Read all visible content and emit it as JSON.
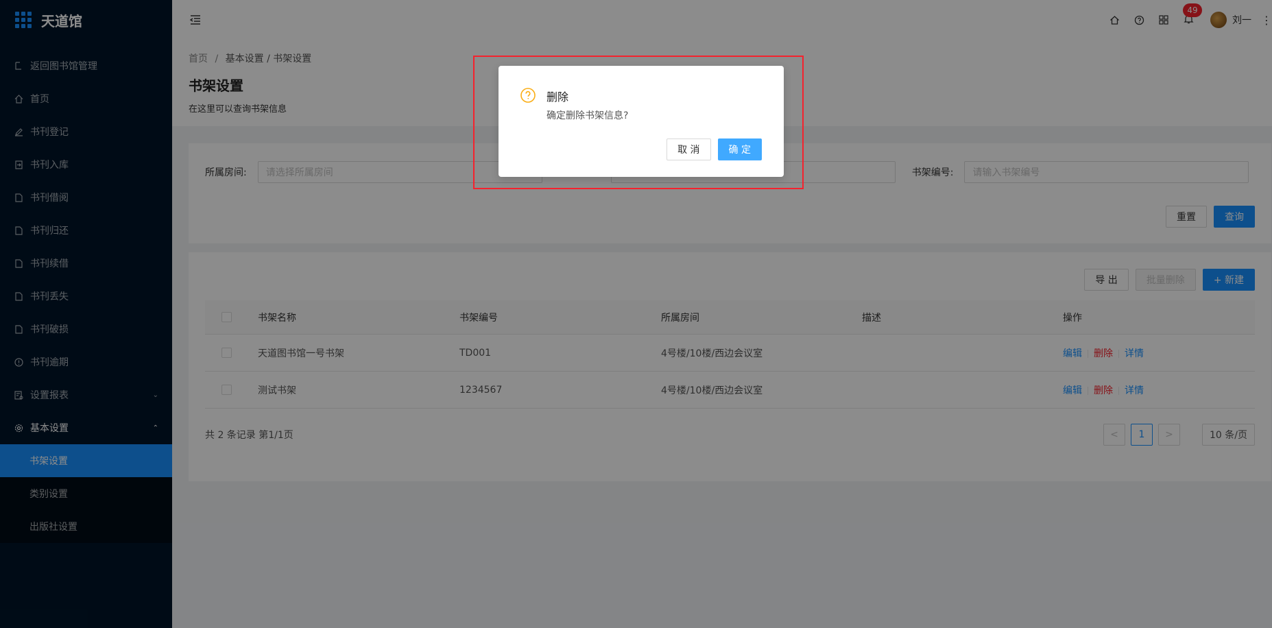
{
  "app": {
    "name": "天道馆"
  },
  "sidebar": {
    "items": [
      {
        "label": "返回图书馆管理",
        "icon": "return-icon"
      },
      {
        "label": "首页",
        "icon": "home-icon"
      },
      {
        "label": "书刊登记",
        "icon": "edit-icon"
      },
      {
        "label": "书刊入库",
        "icon": "import-icon"
      },
      {
        "label": "书刊借阅",
        "icon": "file-icon"
      },
      {
        "label": "书刊归还",
        "icon": "file-icon"
      },
      {
        "label": "书刊续借",
        "icon": "file-icon"
      },
      {
        "label": "书刊丢失",
        "icon": "file-icon"
      },
      {
        "label": "书刊破损",
        "icon": "file-icon"
      },
      {
        "label": "书刊逾期",
        "icon": "warning-circle-icon"
      },
      {
        "label": "设置报表",
        "icon": "report-icon"
      },
      {
        "label": "基本设置",
        "icon": "gear-icon"
      }
    ],
    "submenu": [
      {
        "label": "书架设置"
      },
      {
        "label": "类别设置"
      },
      {
        "label": "出版社设置"
      }
    ]
  },
  "header": {
    "notifications": "49",
    "username": "刘一"
  },
  "breadcrumb": {
    "home": "首页",
    "sep": "/",
    "parent": "基本设置 / 书架设置"
  },
  "page": {
    "title": "书架设置",
    "desc": "在这里可以查询书架信息"
  },
  "filters": {
    "room_label": "所属房间:",
    "room_placeholder": "请选择所属房间",
    "code_label": "书架编号:",
    "code_placeholder": "请输入书架编号",
    "reset": "重置",
    "query": "查询"
  },
  "toolbar": {
    "export": "导 出",
    "batch_delete": "批量删除",
    "create": "+ 新建"
  },
  "table": {
    "columns": [
      "书架名称",
      "书架编号",
      "所属房间",
      "描述",
      "操作"
    ],
    "rows": [
      {
        "name": "天道图书馆一号书架",
        "code": "TD001",
        "room": "4号楼/10楼/西边会议室",
        "desc": ""
      },
      {
        "name": "测试书架",
        "code": "1234567",
        "room": "4号楼/10楼/西边会议室",
        "desc": ""
      }
    ],
    "actions": {
      "edit": "编辑",
      "delete": "删除",
      "detail": "详情"
    }
  },
  "pagination": {
    "total": "共 2 条记录 第1/1页",
    "prev": "<",
    "current": "1",
    "next": ">",
    "page_size": "10 条/页"
  },
  "modal": {
    "title": "删除",
    "content": "确定删除书架信息?",
    "cancel": "取 消",
    "ok": "确 定"
  },
  "colors": {
    "sidebar_bg": "#001529",
    "primary": "#1890ff",
    "danger": "#f5222d",
    "warning": "#faad14"
  }
}
